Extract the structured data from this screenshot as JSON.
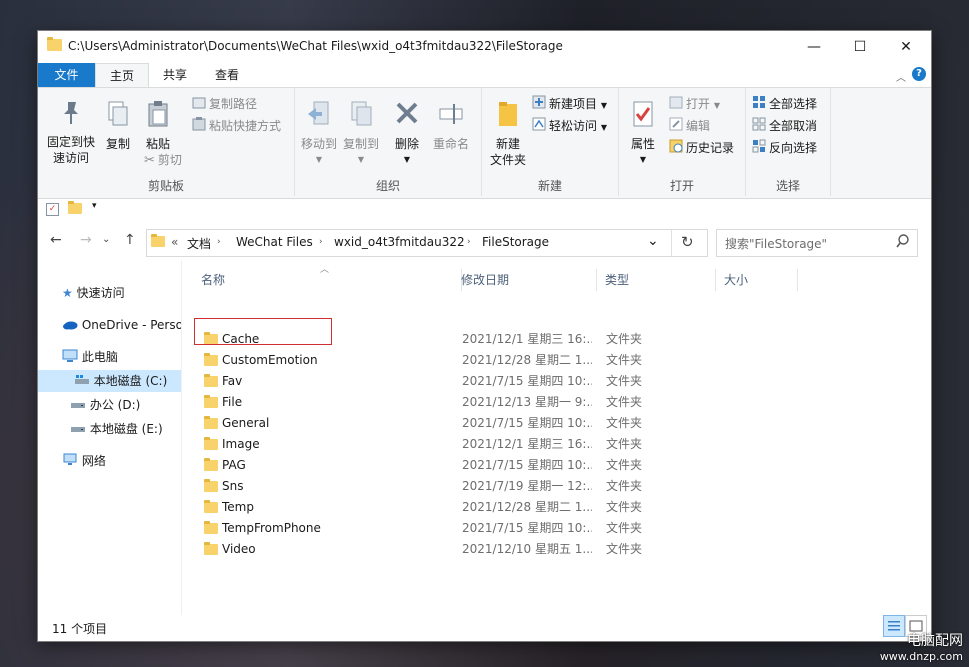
{
  "window": {
    "title": "C:\\Users\\Administrator\\Documents\\WeChat Files\\wxid_o4t3fmitdau322\\FileStorage",
    "minimize": "—",
    "maximize": "☐",
    "close": "✕"
  },
  "ribbon_tabs": [
    {
      "label": "文件"
    },
    {
      "label": "主页"
    },
    {
      "label": "共享"
    },
    {
      "label": "查看"
    }
  ],
  "ribbon_help": "?",
  "ribbon": {
    "clipboard": {
      "pin_label": "固定到快速访问",
      "pin_label_1": "固定到快",
      "pin_label_2": "速访问",
      "copy": "复制",
      "paste": "粘贴",
      "copy_path": "复制路径",
      "paste_shortcut": "粘贴快捷方式",
      "cut": "剪切",
      "group": "剪贴板"
    },
    "organize": {
      "move_to": "移动到",
      "copy_to": "复制到",
      "delete": "删除",
      "rename": "重命名",
      "group": "组织"
    },
    "new": {
      "new_folder_1": "新建",
      "new_folder_2": "文件夹",
      "new_item": "新建项目",
      "easy_access": "轻松访问",
      "group": "新建"
    },
    "open": {
      "properties": "属性",
      "open": "打开",
      "edit": "编辑",
      "history": "历史记录",
      "group": "打开"
    },
    "select": {
      "select_all": "全部选择",
      "select_none": "全部取消",
      "invert": "反向选择",
      "group": "选择"
    }
  },
  "nav": {
    "back": "←",
    "forward": "→",
    "dropdown": "⌄",
    "up": "↑",
    "breadcrumb_prefix": "«",
    "breadcrumb": [
      "文档",
      "WeChat Files",
      "wxid_o4t3fmitdau322",
      "FileStorage"
    ],
    "refresh": "↻",
    "search_placeholder": "搜索\"FileStorage\""
  },
  "sidebar": [
    {
      "label": "快速访问"
    },
    {
      "label": "OneDrive - Perso"
    },
    {
      "label": "此电脑"
    },
    {
      "label": "本地磁盘 (C:)"
    },
    {
      "label": "办公 (D:)"
    },
    {
      "label": "本地磁盘 (E:)"
    },
    {
      "label": "网络"
    }
  ],
  "columns": {
    "name": "名称",
    "date": "修改日期",
    "type": "类型",
    "size": "大小"
  },
  "files": [
    {
      "name": "Cache",
      "date": "2021/12/1 星期三 16:...",
      "type": "文件夹"
    },
    {
      "name": "CustomEmotion",
      "date": "2021/12/28 星期二 1...",
      "type": "文件夹"
    },
    {
      "name": "Fav",
      "date": "2021/7/15 星期四 10:...",
      "type": "文件夹"
    },
    {
      "name": "File",
      "date": "2021/12/13 星期一 9:...",
      "type": "文件夹"
    },
    {
      "name": "General",
      "date": "2021/7/15 星期四 10:...",
      "type": "文件夹"
    },
    {
      "name": "Image",
      "date": "2021/12/1 星期三 16:...",
      "type": "文件夹"
    },
    {
      "name": "PAG",
      "date": "2021/7/15 星期四 10:...",
      "type": "文件夹"
    },
    {
      "name": "Sns",
      "date": "2021/7/19 星期一 12:...",
      "type": "文件夹"
    },
    {
      "name": "Temp",
      "date": "2021/12/28 星期二 1...",
      "type": "文件夹"
    },
    {
      "name": "TempFromPhone",
      "date": "2021/7/15 星期四 10:...",
      "type": "文件夹"
    },
    {
      "name": "Video",
      "date": "2021/12/10 星期五 1...",
      "type": "文件夹"
    }
  ],
  "status": {
    "count": "11 个项目"
  },
  "watermark": {
    "line1": "电脑配网",
    "line2": "www.dnzp.com"
  },
  "colors": {
    "accent": "#1979ca",
    "highlight_border": "#d23030",
    "folder": "#f8d36b",
    "selection": "#cce8ff"
  }
}
